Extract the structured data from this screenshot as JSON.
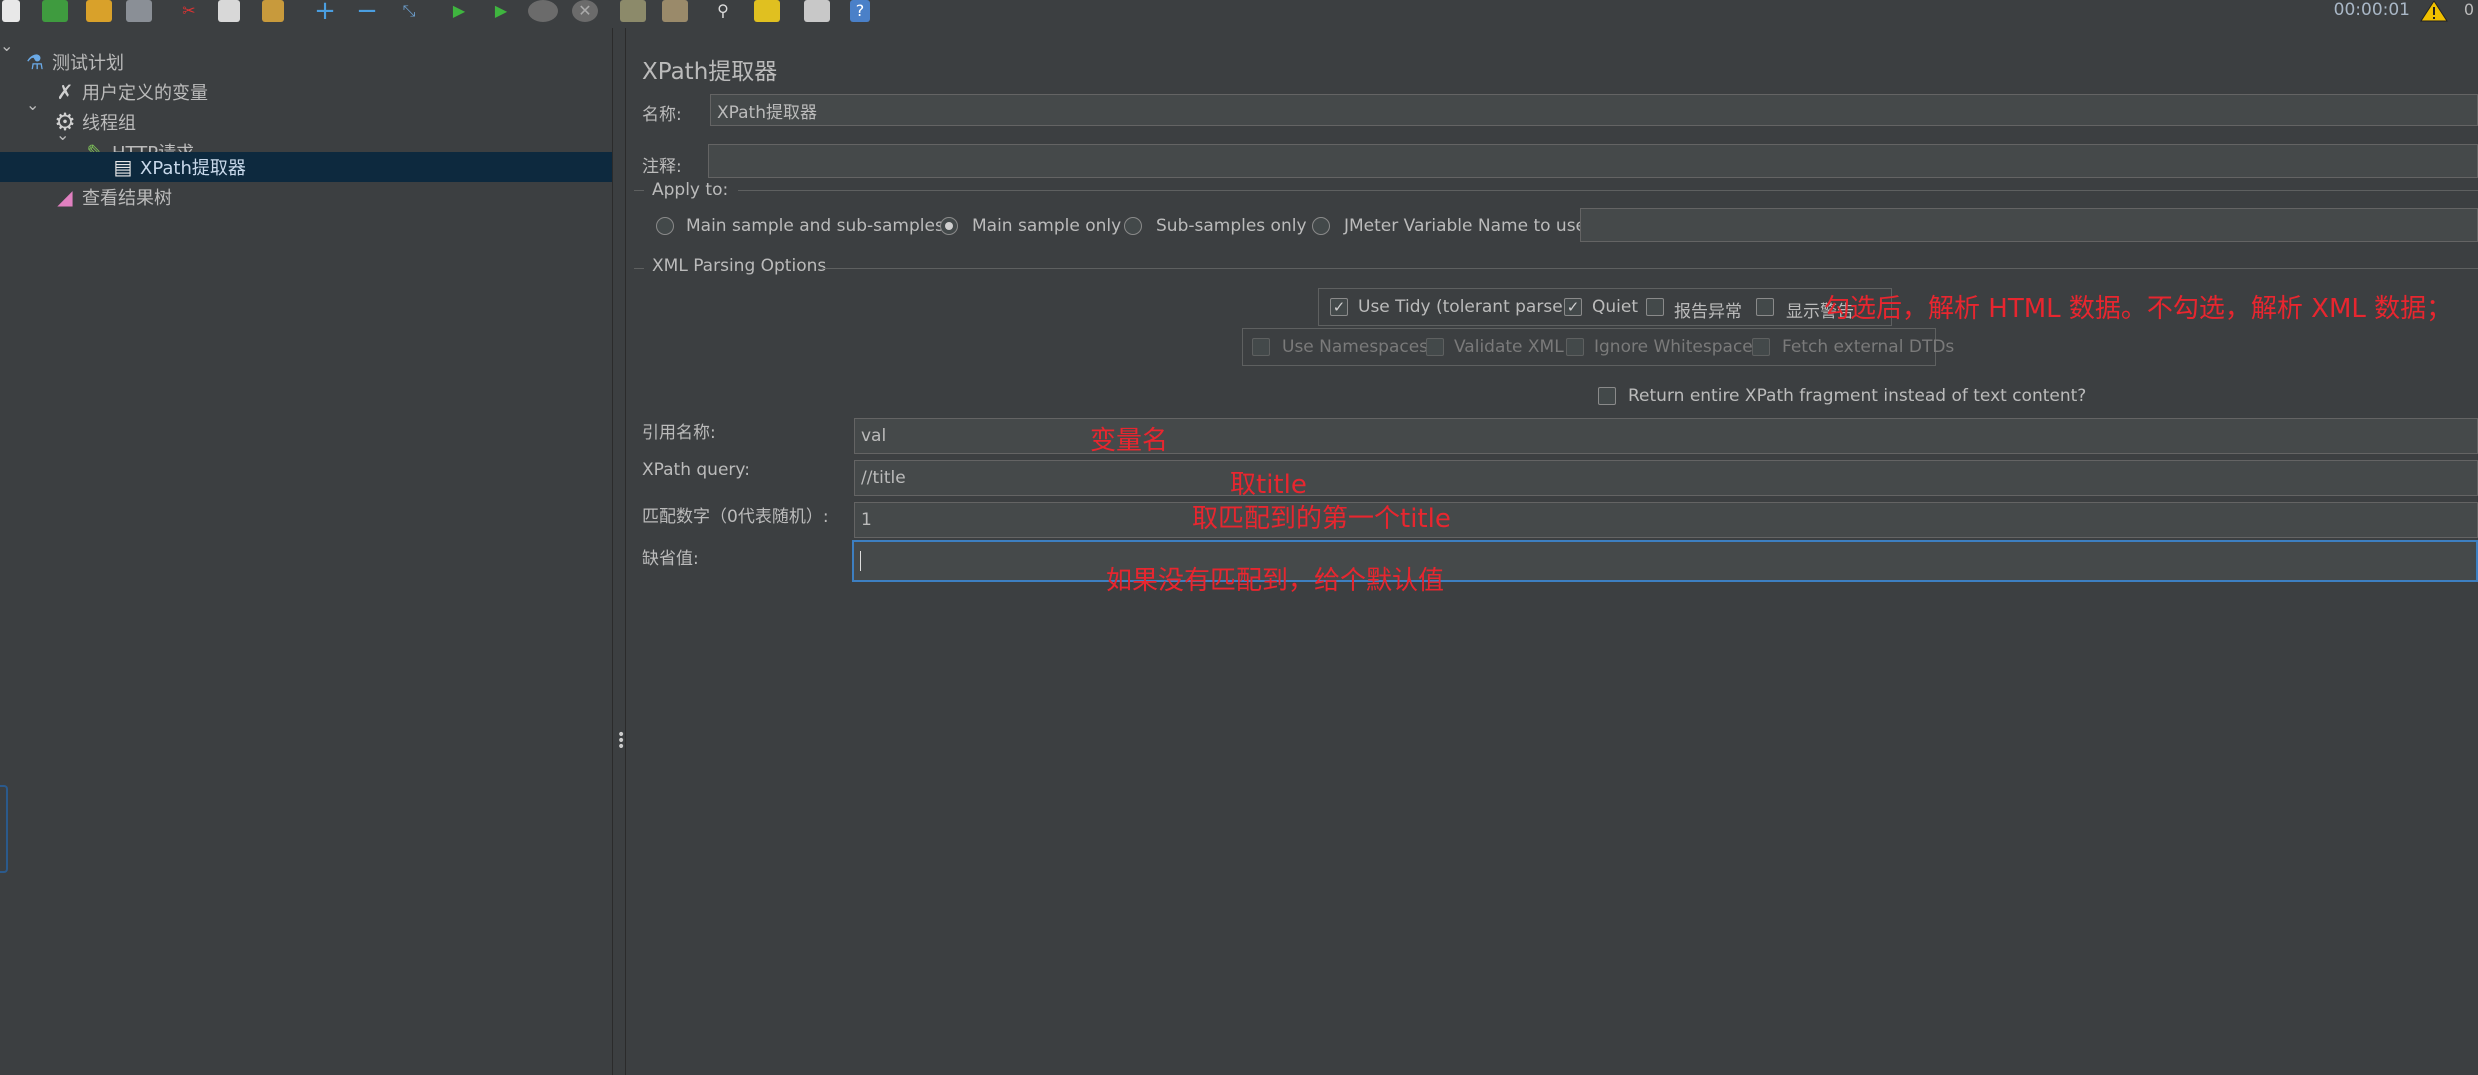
{
  "toolbar": {
    "icons": [
      "new-icon",
      "templates-icon",
      "open-icon",
      "save-icon",
      "cut-icon",
      "copy-icon",
      "paste-icon",
      "expand-icon",
      "collapse-icon",
      "toggle-icon",
      "start-icon",
      "start-no-pause-icon",
      "stop-icon",
      "shutdown-icon",
      "clear-icon",
      "clear-all-icon",
      "search-icon",
      "reset-search-icon",
      "function-helper-icon",
      "help-icon"
    ],
    "timer": "00:00:01",
    "warning_count": "0"
  },
  "tree": {
    "items": [
      {
        "label": "测试计划",
        "icon": "test-plan-icon"
      },
      {
        "label": "用户定义的变量",
        "icon": "variables-icon"
      },
      {
        "label": "线程组",
        "icon": "thread-group-icon"
      },
      {
        "label": "HTTP请求",
        "icon": "sampler-icon"
      },
      {
        "label": "XPath提取器",
        "icon": "extractor-icon"
      },
      {
        "label": "查看结果树",
        "icon": "listener-icon"
      }
    ]
  },
  "panel": {
    "title": "XPath提取器",
    "name_label": "名称:",
    "name_value": "XPath提取器",
    "comment_label": "注释:",
    "comment_value": "",
    "apply_to": {
      "legend": "Apply to:",
      "options": [
        "Main sample and sub-samples",
        "Main sample only",
        "Sub-samples only",
        "JMeter Variable Name to use"
      ],
      "selected": "Main sample only",
      "variable_value": ""
    },
    "xml_options": {
      "legend": "XML Parsing Options",
      "use_tidy": "Use Tidy (tolerant parser)",
      "quiet": "Quiet",
      "report_errors": "报告异常",
      "show_warnings": "显示警告",
      "use_namespaces": "Use Namespaces",
      "validate_xml": "Validate XML",
      "ignore_whitespace": "Ignore Whitespace",
      "fetch_dtds": "Fetch external DTDs",
      "return_fragment": "Return entire XPath fragment instead of text content?"
    },
    "ref_name_label": "引用名称:",
    "ref_name_value": "val",
    "xpath_label": "XPath query:",
    "xpath_value": "//title",
    "match_label": "匹配数字（0代表随机）:",
    "match_value": "1",
    "default_label": "缺省值:",
    "default_value": ""
  },
  "annotations": {
    "tidy_note": "勾选后，解析 HTML 数据。不勾选，解析 XML 数据；",
    "var_note": "变量名",
    "title_note": "取title",
    "first_note": "取匹配到的第一个title",
    "default_note": "如果没有匹配到，给个默认值"
  },
  "colors": {
    "background": "#3c3f41",
    "field": "#45494a",
    "selection": "#0d293e",
    "annotation": "#e8262f",
    "focus": "#3d7fc1"
  }
}
